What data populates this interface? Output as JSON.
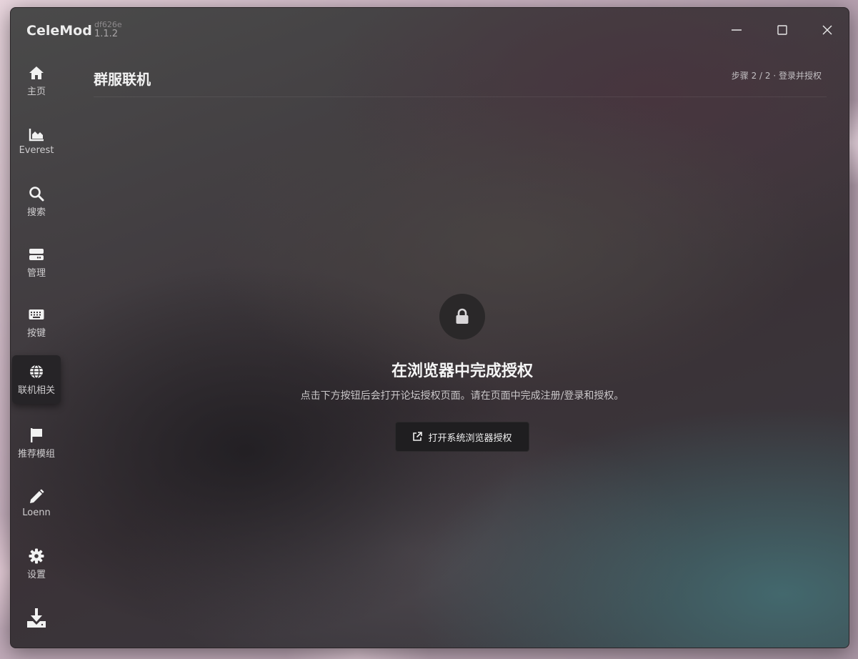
{
  "app": {
    "name": "CeleMod",
    "hash": "df626e",
    "version": "1.1.2"
  },
  "window_controls": {
    "minimize_icon": "minimize-icon",
    "maximize_icon": "maximize-icon",
    "close_icon": "close-icon"
  },
  "sidebar": {
    "items": [
      {
        "label": "主页",
        "icon": "home-icon",
        "active": false
      },
      {
        "label": "Everest",
        "icon": "chart-area-icon",
        "active": false
      },
      {
        "label": "搜索",
        "icon": "search-icon",
        "active": false
      },
      {
        "label": "管理",
        "icon": "hard-drive-icon",
        "active": false
      },
      {
        "label": "按键",
        "icon": "keyboard-icon",
        "active": false
      },
      {
        "label": "联机相关",
        "icon": "globe-icon",
        "active": true
      },
      {
        "label": "推荐模组",
        "icon": "flag-icon",
        "active": false
      },
      {
        "label": "Loenn",
        "icon": "pencil-icon",
        "active": false
      },
      {
        "label": "设置",
        "icon": "gear-icon",
        "active": false
      },
      {
        "label": "",
        "icon": "download-icon",
        "active": false
      }
    ]
  },
  "header": {
    "title": "群服联机",
    "step": "步骤 2 / 2 · 登录并授权"
  },
  "main": {
    "icon": "lock-icon",
    "heading": "在浏览器中完成授权",
    "description": "点击下方按钮后会打开论坛授权页面。请在页面中完成注册/登录和授权。",
    "button_label": "打开系统浏览器授权",
    "button_icon": "external-link-icon"
  },
  "colors": {
    "accent_surface": "#262427",
    "text_primary": "#f2f2f2",
    "text_secondary": "#c9c6c8"
  }
}
